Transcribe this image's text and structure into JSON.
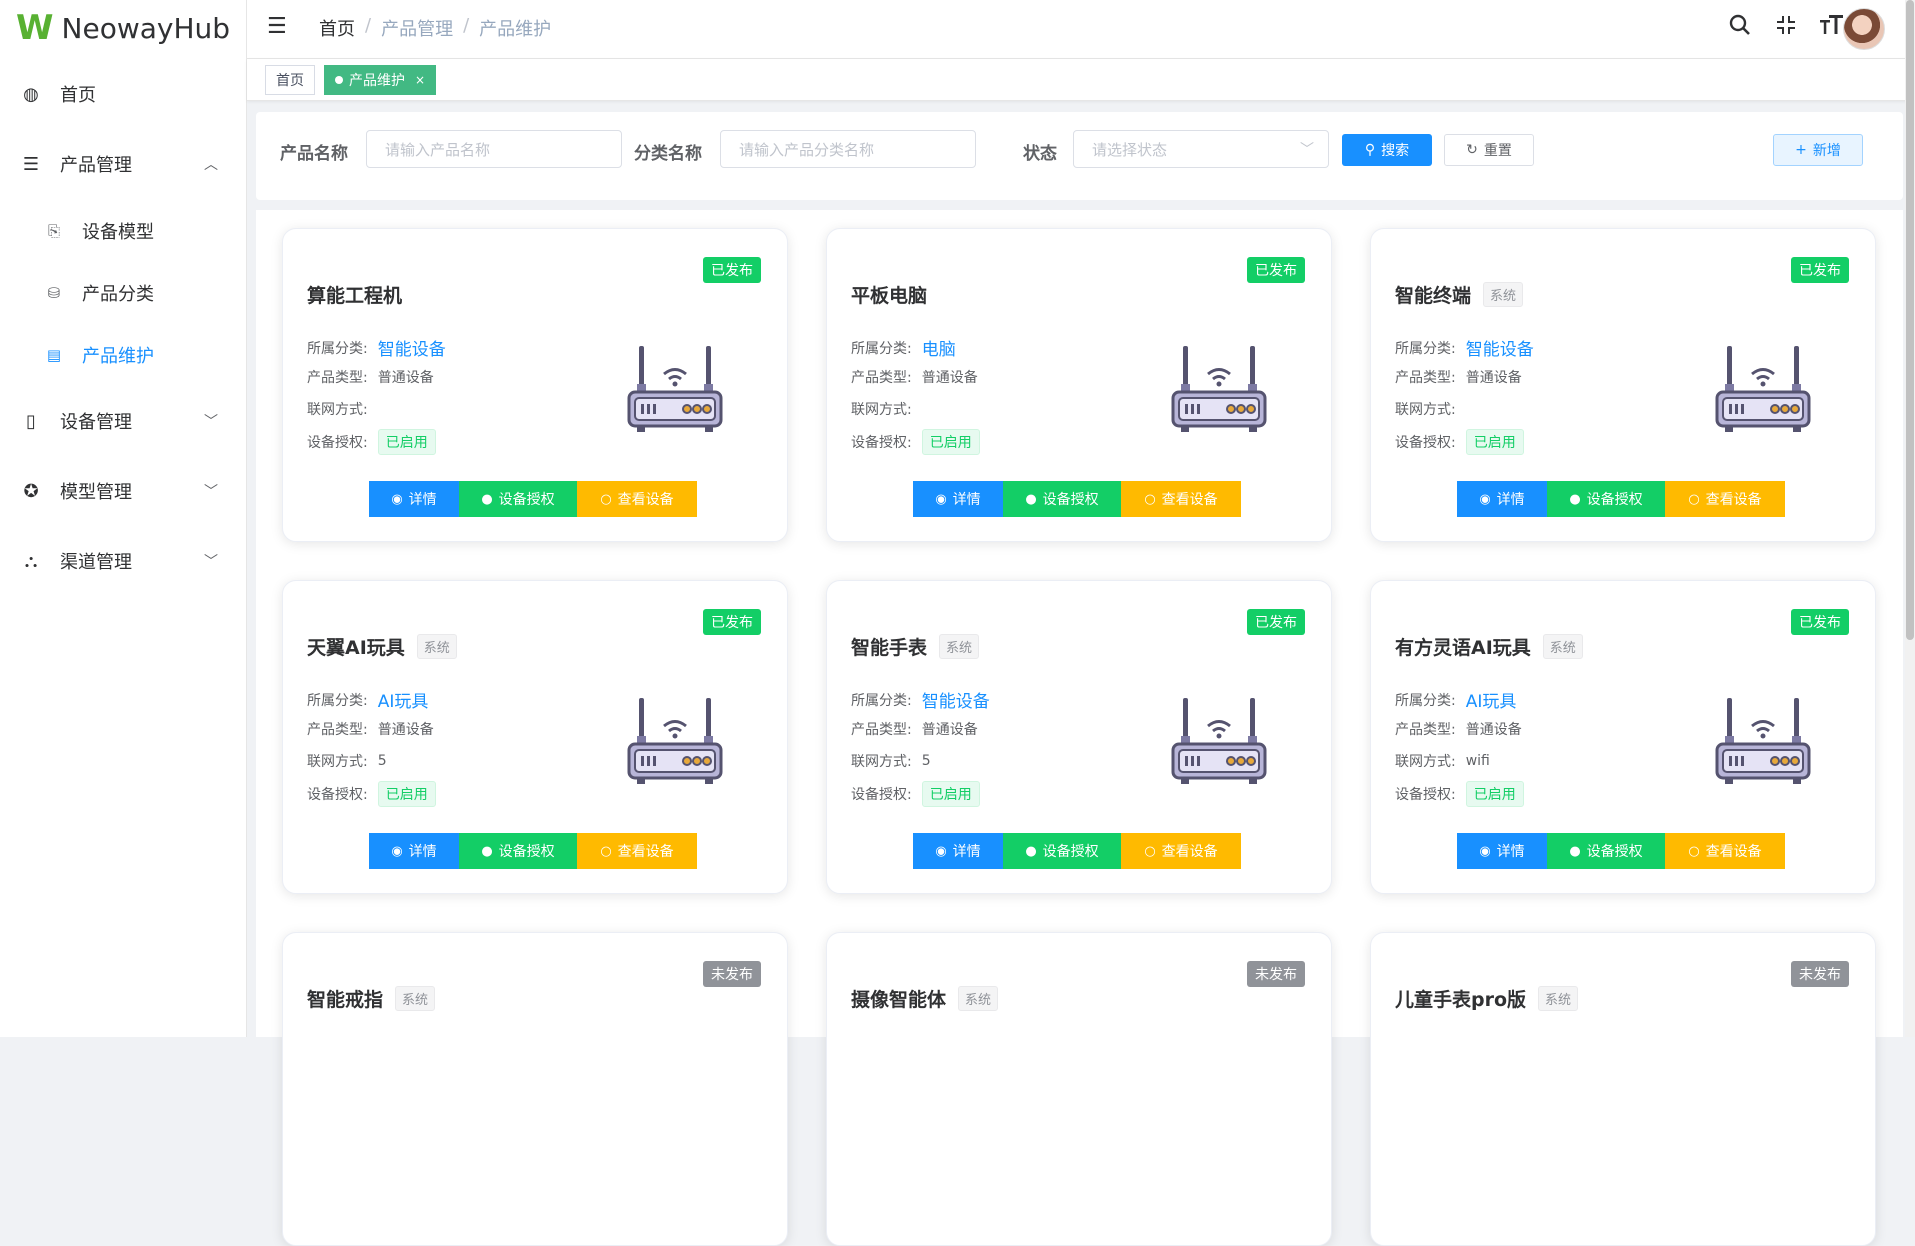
{
  "app": {
    "logo_letter": "W",
    "name": "NeowayHub"
  },
  "sidebar": {
    "items": [
      {
        "icon": "dashboard-icon",
        "glyph": "◍",
        "label": "首页"
      },
      {
        "icon": "list-icon",
        "glyph": "☰",
        "label": "产品管理",
        "chevron": "︿"
      },
      {
        "icon": "device-model-icon",
        "glyph": "⎘",
        "label": "设备模型"
      },
      {
        "icon": "category-icon",
        "glyph": "⛁",
        "label": "产品分类"
      },
      {
        "icon": "product-maintain-icon",
        "glyph": "▤",
        "label": "产品维护"
      },
      {
        "icon": "phone-icon",
        "glyph": "▯",
        "label": "设备管理",
        "chevron": "﹀"
      },
      {
        "icon": "model-icon",
        "glyph": "✪",
        "label": "模型管理",
        "chevron": "﹀"
      },
      {
        "icon": "channel-icon",
        "glyph": "⛬",
        "label": "渠道管理",
        "chevron": "﹀"
      }
    ]
  },
  "header": {
    "breadcrumb": [
      "首页",
      "产品管理",
      "产品维护"
    ],
    "sep": "/"
  },
  "tags": [
    {
      "label": "首页"
    },
    {
      "label": "产品维护",
      "close": "×"
    }
  ],
  "search": {
    "name_label": "产品名称",
    "name_placeholder": "请输入产品名称",
    "category_label": "分类名称",
    "category_placeholder": "请输入产品分类名称",
    "status_label": "状态",
    "status_placeholder": "请选择状态",
    "search_btn": "搜索",
    "reset_btn": "重置",
    "add_btn": "新增"
  },
  "field_labels": {
    "category": "所属分类:",
    "type": "产品类型:",
    "network": "联网方式:",
    "auth": "设备授权:"
  },
  "actions": {
    "detail": "详情",
    "authorize": "设备授权",
    "view": "查看设备"
  },
  "cards": [
    {
      "name": "算能工程机",
      "sys": "",
      "status": "已发布",
      "category": "智能设备",
      "type": "普通设备",
      "network": "",
      "auth": "已启用"
    },
    {
      "name": "平板电脑",
      "sys": "",
      "status": "已发布",
      "category": "电脑",
      "type": "普通设备",
      "network": "",
      "auth": "已启用"
    },
    {
      "name": "智能终端",
      "sys": "系统",
      "status": "已发布",
      "category": "智能设备",
      "type": "普通设备",
      "network": "",
      "auth": "已启用"
    },
    {
      "name": "天翼AI玩具",
      "sys": "系统",
      "status": "已发布",
      "category": "AI玩具",
      "type": "普通设备",
      "network": "5",
      "auth": "已启用"
    },
    {
      "name": "智能手表",
      "sys": "系统",
      "status": "已发布",
      "category": "智能设备",
      "type": "普通设备",
      "network": "5",
      "auth": "已启用"
    },
    {
      "name": "有方灵语AI玩具",
      "sys": "系统",
      "status": "已发布",
      "category": "AI玩具",
      "type": "普通设备",
      "network": "wifi",
      "auth": "已启用"
    },
    {
      "name": "智能戒指",
      "sys": "系统",
      "status": "未发布",
      "category": "",
      "type": "",
      "network": "",
      "auth": ""
    },
    {
      "name": "摄像智能体",
      "sys": "系统",
      "status": "未发布",
      "category": "",
      "type": "",
      "network": "",
      "auth": ""
    },
    {
      "name": "儿童手表pro版",
      "sys": "系统",
      "status": "未发布",
      "category": "",
      "type": "",
      "network": "",
      "auth": ""
    }
  ],
  "colors": {
    "primary": "#1890ff",
    "success": "#13ce66",
    "warning": "#ffba00",
    "tag_active": "#42b983",
    "unpublished": "#909399"
  }
}
